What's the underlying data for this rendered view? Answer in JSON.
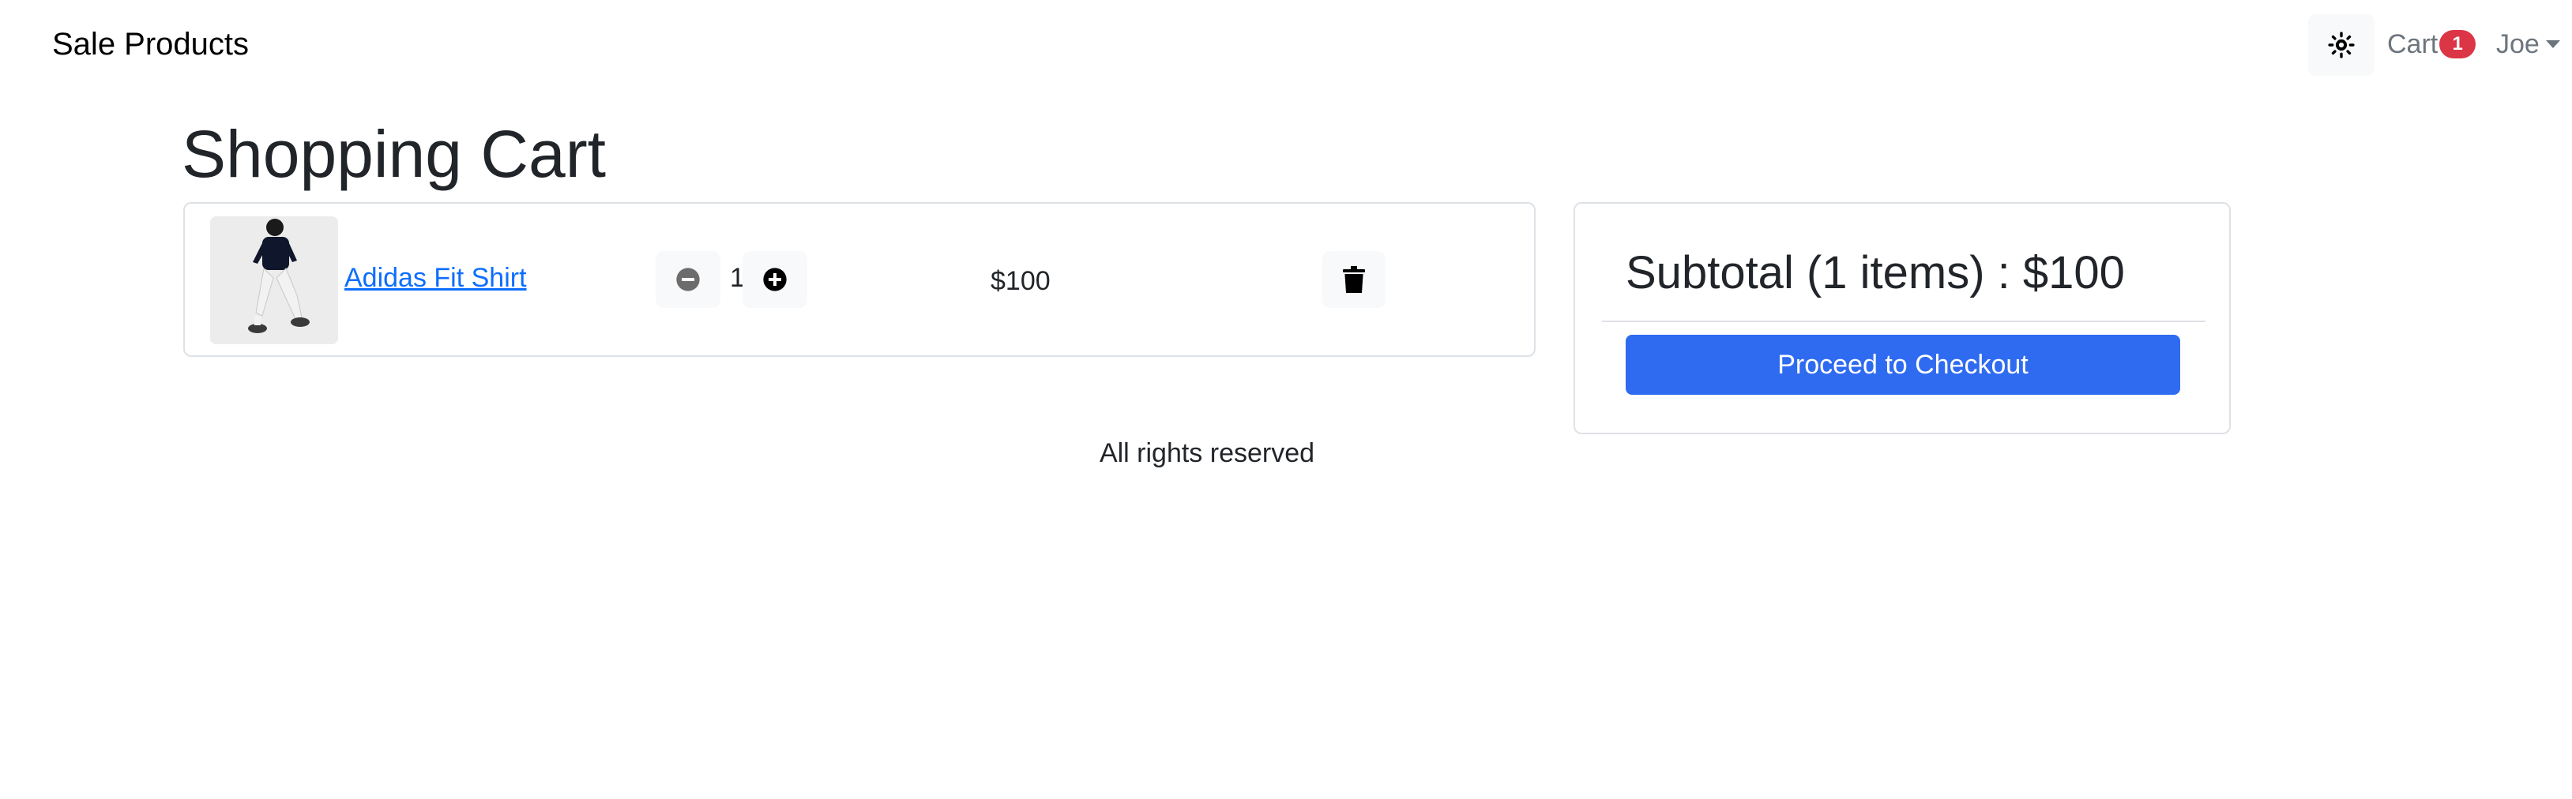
{
  "navbar": {
    "brand": "Sale Products",
    "theme_toggle_icon": "sun-icon",
    "cart_label": "Cart",
    "cart_count": "1",
    "user_name": "Joe"
  },
  "page": {
    "title": "Shopping Cart"
  },
  "cart": {
    "items": [
      {
        "name": "Adidas Fit Shirt",
        "image": "product-photo-shirt",
        "quantity": "1",
        "price": "$100"
      }
    ]
  },
  "summary": {
    "subtotal_text": "Subtotal (1 items) : $100",
    "checkout_label": "Proceed to Checkout"
  },
  "footer": {
    "text": "All rights reserved"
  },
  "colors": {
    "primary": "#2f6bf0",
    "badge": "#dc3545",
    "link": "#0d6efd"
  }
}
